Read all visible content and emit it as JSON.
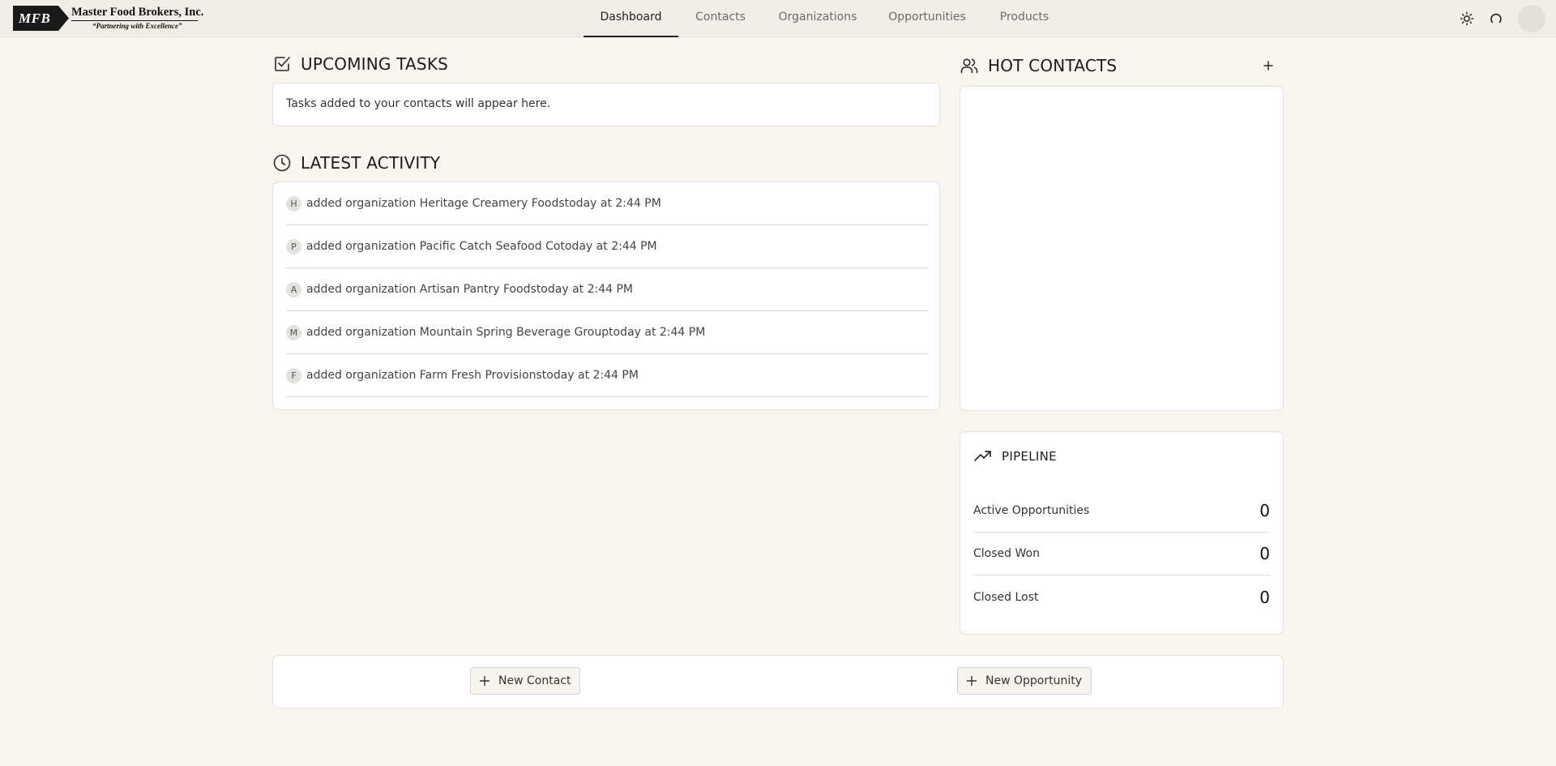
{
  "header": {
    "logo": {
      "mark": "MFB",
      "name": "Master Food Brokers, Inc.",
      "tagline": "“Partnering with Excellence”"
    },
    "nav": [
      {
        "label": "Dashboard",
        "active": true
      },
      {
        "label": "Contacts",
        "active": false
      },
      {
        "label": "Organizations",
        "active": false
      },
      {
        "label": "Opportunities",
        "active": false
      },
      {
        "label": "Products",
        "active": false
      }
    ],
    "icons": [
      "sun-icon",
      "refresh-icon",
      "avatar"
    ]
  },
  "upcoming_tasks": {
    "title": "UPCOMING TASKS",
    "empty_text": "Tasks added to your contacts will appear here."
  },
  "latest_activity": {
    "title": "LATEST ACTIVITY",
    "items": [
      {
        "initial": "H",
        "text": "added organization Heritage Creamery Foodstoday at 2:44 PM"
      },
      {
        "initial": "P",
        "text": "added organization Pacific Catch Seafood Cotoday at 2:44 PM"
      },
      {
        "initial": "A",
        "text": "added organization Artisan Pantry Foodstoday at 2:44 PM"
      },
      {
        "initial": "M",
        "text": "added organization Mountain Spring Beverage Grouptoday at 2:44 PM"
      },
      {
        "initial": "F",
        "text": "added organization Farm Fresh Provisionstoday at 2:44 PM"
      }
    ]
  },
  "hot_contacts": {
    "title": "HOT CONTACTS"
  },
  "pipeline": {
    "title": "PIPELINE",
    "rows": [
      {
        "label": "Active Opportunities",
        "value": "0"
      },
      {
        "label": "Closed Won",
        "value": "0"
      },
      {
        "label": "Closed Lost",
        "value": "0"
      }
    ]
  },
  "actions": {
    "new_contact": "New Contact",
    "new_opportunity": "New Opportunity"
  },
  "colors": {
    "page_bg": "#f8f5ef",
    "topbar_bg": "#f1eee8",
    "card_bg": "#ffffff",
    "card_border": "#e6e1d8",
    "text_primary": "#1c1c1c",
    "text_muted": "#6b6b6b"
  }
}
